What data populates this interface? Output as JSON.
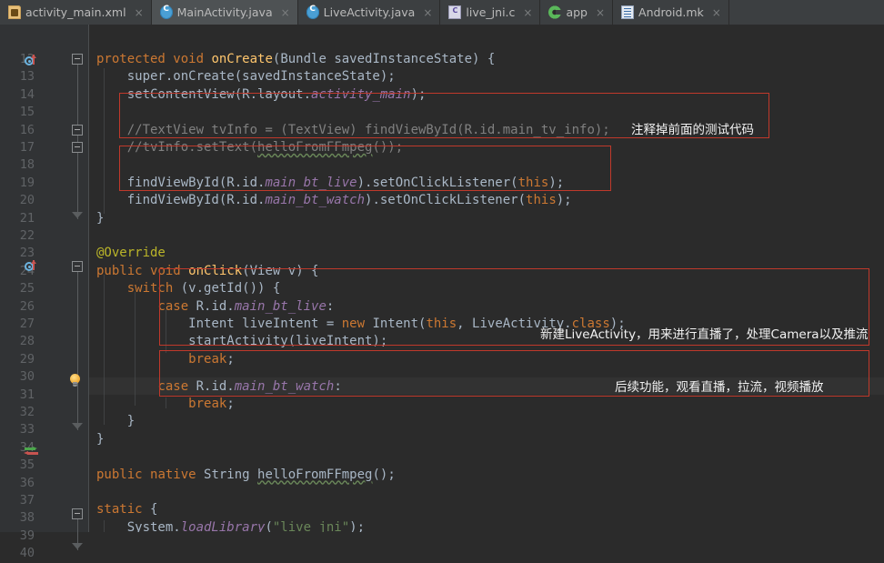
{
  "window": {
    "app": "Android Studio Editor",
    "theme_bg": "#2b2b2b",
    "gutter_bg": "#313335",
    "tabbar_bg": "#3c3f41",
    "accent_red": "#c0392b"
  },
  "tabs": [
    {
      "label": "activity_main.xml",
      "icon": "xml-file-icon",
      "active": false,
      "close": "×"
    },
    {
      "label": "MainActivity.java",
      "icon": "java-class-icon",
      "active": true,
      "close": "×"
    },
    {
      "label": "LiveActivity.java",
      "icon": "java-class-icon",
      "active": false,
      "close": "×"
    },
    {
      "label": "live_jni.c",
      "icon": "c-file-icon",
      "active": false,
      "close": "×"
    },
    {
      "label": "app",
      "icon": "module-icon",
      "active": false,
      "close": "×"
    },
    {
      "label": "Android.mk",
      "icon": "text-file-icon",
      "active": false,
      "close": "×"
    }
  ],
  "editor": {
    "first_line": 12,
    "last_line": 40,
    "current_line": 32,
    "line_numbers": [
      12,
      13,
      14,
      15,
      16,
      17,
      18,
      19,
      20,
      21,
      22,
      23,
      24,
      25,
      26,
      27,
      28,
      29,
      30,
      31,
      32,
      33,
      34,
      35,
      36,
      37,
      38,
      39,
      40
    ],
    "lines": {
      "12": "protected void onCreate(Bundle savedInstanceState) {",
      "13": "    super.onCreate(savedInstanceState);",
      "14": "    setContentView(R.layout.activity_main);",
      "15": "",
      "16": "    //TextView tvInfo = (TextView) findViewById(R.id.main_tv_info);",
      "17": "    //tvInfo.setText(helloFromFFmpeg());",
      "18": "",
      "19": "    findViewById(R.id.main_bt_live).setOnClickListener(this);",
      "20": "    findViewById(R.id.main_bt_watch).setOnClickListener(this);",
      "21": "}",
      "22": "",
      "23": "@Override",
      "24": "public void onClick(View v) {",
      "25": "    switch (v.getId()) {",
      "26": "        case R.id.main_bt_live:",
      "27": "            Intent liveIntent = new Intent(this, LiveActivity.class);",
      "28": "            startActivity(liveIntent);",
      "29": "            break;",
      "30": "",
      "31": "        case R.id.main_bt_watch:",
      "32": "            break;",
      "33": "    }",
      "34": "}",
      "35": "",
      "36": "public native String helloFromFFmpeg();",
      "37": "",
      "38": "static {",
      "39": "    System.loadLibrary(\"live_jni\");",
      "40": "}"
    }
  },
  "annotations": [
    {
      "id": "note-commented-test-code",
      "text": "注释掉前面的测试代码"
    },
    {
      "id": "note-live-activity",
      "text": "新建LiveActivity，用来进行直播了，处理Camera以及推流"
    },
    {
      "id": "note-future-feature",
      "text": "后续功能，观看直播，拉流，视频播放"
    }
  ],
  "gutter_icons": [
    {
      "line": 12,
      "name": "override-method-icon"
    },
    {
      "line": 24,
      "name": "override-method-icon"
    },
    {
      "line": 32,
      "name": "intention-bulb-icon"
    },
    {
      "line": 36,
      "name": "native-method-icon"
    }
  ],
  "code_tokens": {
    "l12": [
      [
        "kw",
        "protected"
      ],
      [
        "plain",
        " "
      ],
      [
        "kw",
        "void"
      ],
      [
        "plain",
        " "
      ],
      [
        "meth",
        "onCreate"
      ],
      [
        "plain",
        "(Bundle savedInstanceState) {"
      ]
    ],
    "l13": [
      [
        "plain",
        "    super.onCreate(savedInstanceState);"
      ]
    ],
    "l14": [
      [
        "plain",
        "    setContentView(R.layout."
      ],
      [
        "fld",
        "activity_main"
      ],
      [
        "plain",
        ");"
      ]
    ],
    "l16": [
      [
        "cmt",
        "    //TextView tvInfo = (TextView) findViewById(R.id.main_tv_info);"
      ]
    ],
    "l17a": [
      [
        "cmt",
        "    //tvInfo.setText("
      ]
    ],
    "l17b": [
      [
        "cmt",
        "helloFromFFmpeg"
      ]
    ],
    "l17c": [
      [
        "cmt",
        "());"
      ]
    ],
    "l19": [
      [
        "plain",
        "    findViewById(R.id."
      ],
      [
        "fld",
        "main_bt_live"
      ],
      [
        "plain",
        ").setOnClickListener("
      ],
      [
        "kw",
        "this"
      ],
      [
        "plain",
        ");"
      ]
    ],
    "l20": [
      [
        "plain",
        "    findViewById(R.id."
      ],
      [
        "fld",
        "main_bt_watch"
      ],
      [
        "plain",
        ").setOnClickListener("
      ],
      [
        "kw",
        "this"
      ],
      [
        "plain",
        ");"
      ]
    ],
    "l21": [
      [
        "plain",
        "}"
      ]
    ],
    "l23": [
      [
        "anno",
        "@Override"
      ]
    ],
    "l24": [
      [
        "kw",
        "public"
      ],
      [
        "plain",
        " "
      ],
      [
        "kw",
        "void"
      ],
      [
        "plain",
        " "
      ],
      [
        "meth",
        "onClick"
      ],
      [
        "plain",
        "(View v) {"
      ]
    ],
    "l25": [
      [
        "plain",
        "    "
      ],
      [
        "kw",
        "switch"
      ],
      [
        "plain",
        " (v.getId()) {"
      ]
    ],
    "l26": [
      [
        "plain",
        "        "
      ],
      [
        "kw",
        "case"
      ],
      [
        "plain",
        " R.id."
      ],
      [
        "fld",
        "main_bt_live"
      ],
      [
        "plain",
        ":"
      ]
    ],
    "l27": [
      [
        "plain",
        "            Intent liveIntent = "
      ],
      [
        "kw",
        "new"
      ],
      [
        "plain",
        " Intent("
      ],
      [
        "kw",
        "this"
      ],
      [
        "plain",
        ", LiveActivity."
      ],
      [
        "kw",
        "class"
      ],
      [
        "plain",
        ");"
      ]
    ],
    "l28": [
      [
        "plain",
        "            startActivity(liveIntent);"
      ]
    ],
    "l29": [
      [
        "plain",
        "            "
      ],
      [
        "kw",
        "break"
      ],
      [
        "plain",
        ";"
      ]
    ],
    "l31": [
      [
        "plain",
        "        "
      ],
      [
        "kw",
        "case"
      ],
      [
        "plain",
        " R.id."
      ],
      [
        "fld",
        "main_bt_watch"
      ],
      [
        "plain",
        ":"
      ]
    ],
    "l32": [
      [
        "plain",
        "            "
      ],
      [
        "kw",
        "break"
      ],
      [
        "plain",
        ";"
      ]
    ],
    "l33": [
      [
        "plain",
        "    }"
      ]
    ],
    "l34": [
      [
        "plain",
        "}"
      ]
    ],
    "l36a": [
      [
        "kw",
        "public"
      ],
      [
        "plain",
        " "
      ],
      [
        "kw",
        "native"
      ],
      [
        "plain",
        " String "
      ]
    ],
    "l36b": [
      [
        "plain",
        "helloFromFFmpeg"
      ]
    ],
    "l36c": [
      [
        "plain",
        "();"
      ]
    ],
    "l38": [
      [
        "kw",
        "static"
      ],
      [
        "plain",
        " {"
      ]
    ],
    "l39": [
      [
        "plain",
        "    System."
      ],
      [
        "fld",
        "loadLibrary"
      ],
      [
        "plain",
        "("
      ],
      [
        "str",
        "\"live_jni\""
      ],
      [
        "plain",
        ");"
      ]
    ],
    "l40": [
      [
        "plain",
        "}"
      ]
    ]
  }
}
